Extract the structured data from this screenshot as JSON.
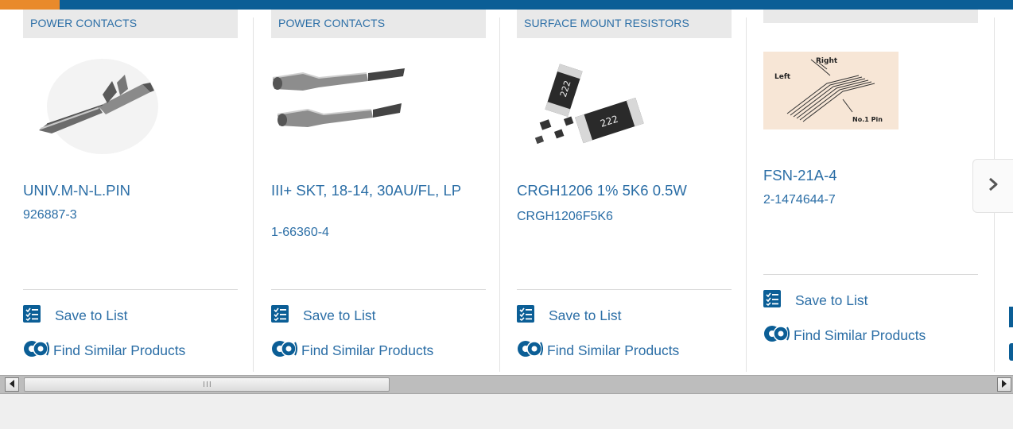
{
  "carousel": {
    "cards": [
      {
        "category": "POWER CONTACTS",
        "name": "UNIV.M-N-L.PIN",
        "part_number": "926887-3",
        "image": "pin-contact"
      },
      {
        "category": "POWER CONTACTS",
        "name": "III+ SKT, 18-14, 30AU/FL, LP",
        "part_number": "1-66360-4",
        "image": "socket-contacts"
      },
      {
        "category": "SURFACE MOUNT RESISTORS",
        "name": "CRGH1206 1% 5K6 0.5W",
        "part_number": "CRGH1206F5K6",
        "image": "smd-resistors",
        "resistor_code": "222"
      },
      {
        "category": "",
        "name": "FSN-21A-4",
        "part_number": "2-1474644-7",
        "image": "flat-cable-diagram",
        "diagram_labels": {
          "right": "Right",
          "left": "Left",
          "pin": "No.1 Pin"
        }
      }
    ],
    "actions": {
      "save_label": "Save to List",
      "similar_label": "Find Similar Products"
    },
    "next_button_icon": "chevron-right-icon"
  },
  "scrollbar": {
    "grip": "III",
    "left_arrow_icon": "left-triangle-icon",
    "right_arrow_icon": "right-triangle-icon"
  },
  "colors": {
    "brand_blue": "#0b5e96",
    "accent_orange": "#e98a2b",
    "link_blue": "#2b6ea6",
    "category_bg": "#e9e9e9"
  }
}
